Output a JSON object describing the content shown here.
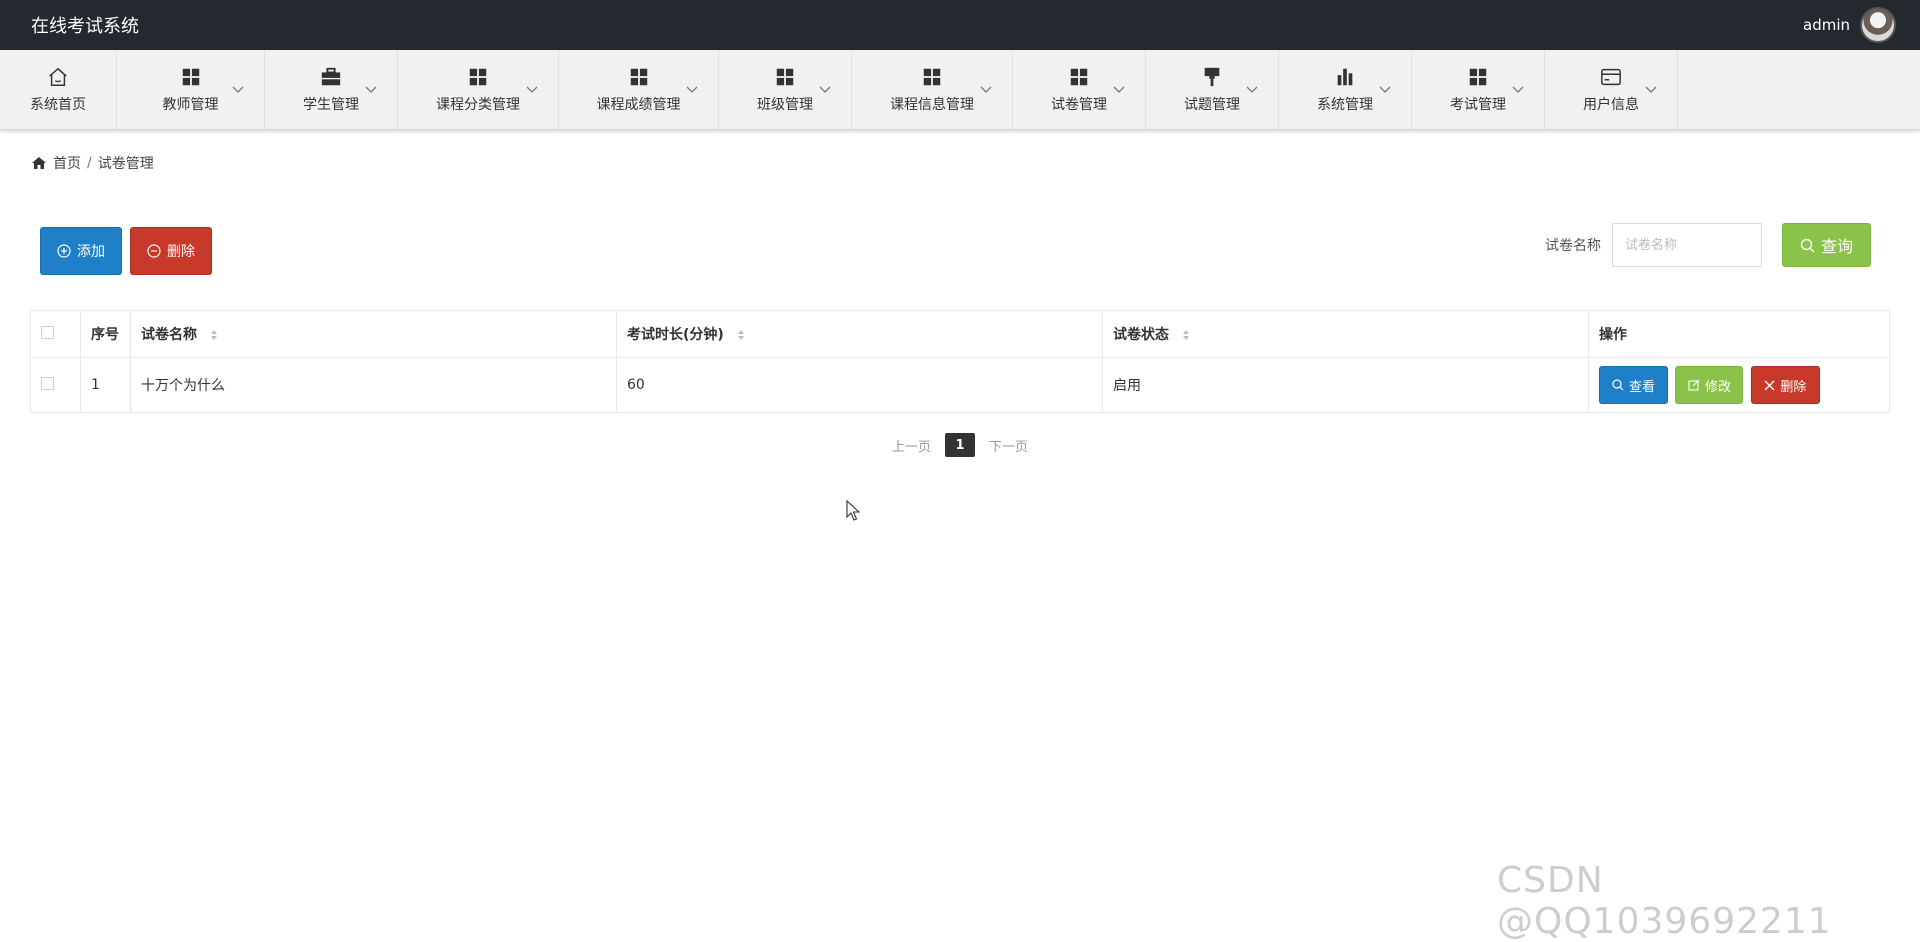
{
  "app": {
    "title": "在线考试系统"
  },
  "user": {
    "name": "admin"
  },
  "nav": {
    "items": [
      {
        "label": "系统首页"
      },
      {
        "label": "教师管理"
      },
      {
        "label": "学生管理"
      },
      {
        "label": "课程分类管理"
      },
      {
        "label": "课程成绩管理"
      },
      {
        "label": "班级管理"
      },
      {
        "label": "课程信息管理"
      },
      {
        "label": "试卷管理"
      },
      {
        "label": "试题管理"
      },
      {
        "label": "系统管理"
      },
      {
        "label": "考试管理"
      },
      {
        "label": "用户信息"
      }
    ]
  },
  "breadcrumb": {
    "home": "首页",
    "separator": "/",
    "current": "试卷管理"
  },
  "toolbar": {
    "add_label": "添加",
    "delete_label": "删除"
  },
  "search": {
    "label": "试卷名称",
    "placeholder": "试卷名称",
    "query_label": "查询"
  },
  "table": {
    "headers": {
      "index": "序号",
      "name": "试卷名称",
      "duration": "考试时长(分钟)",
      "status": "试卷状态",
      "actions": "操作"
    },
    "rows": [
      {
        "index": "1",
        "name": "十万个为什么",
        "duration": "60",
        "status": "启用"
      }
    ],
    "row_actions": {
      "view": "查看",
      "edit": "修改",
      "delete": "删除"
    }
  },
  "pagination": {
    "prev": "上一页",
    "current": "1",
    "next": "下一页"
  },
  "watermark": "CSDN @QQ1039692211",
  "colors": {
    "topbar": "#23292e",
    "primary": "#1f80c9",
    "danger": "#c9392b",
    "success": "#8bc34a"
  }
}
